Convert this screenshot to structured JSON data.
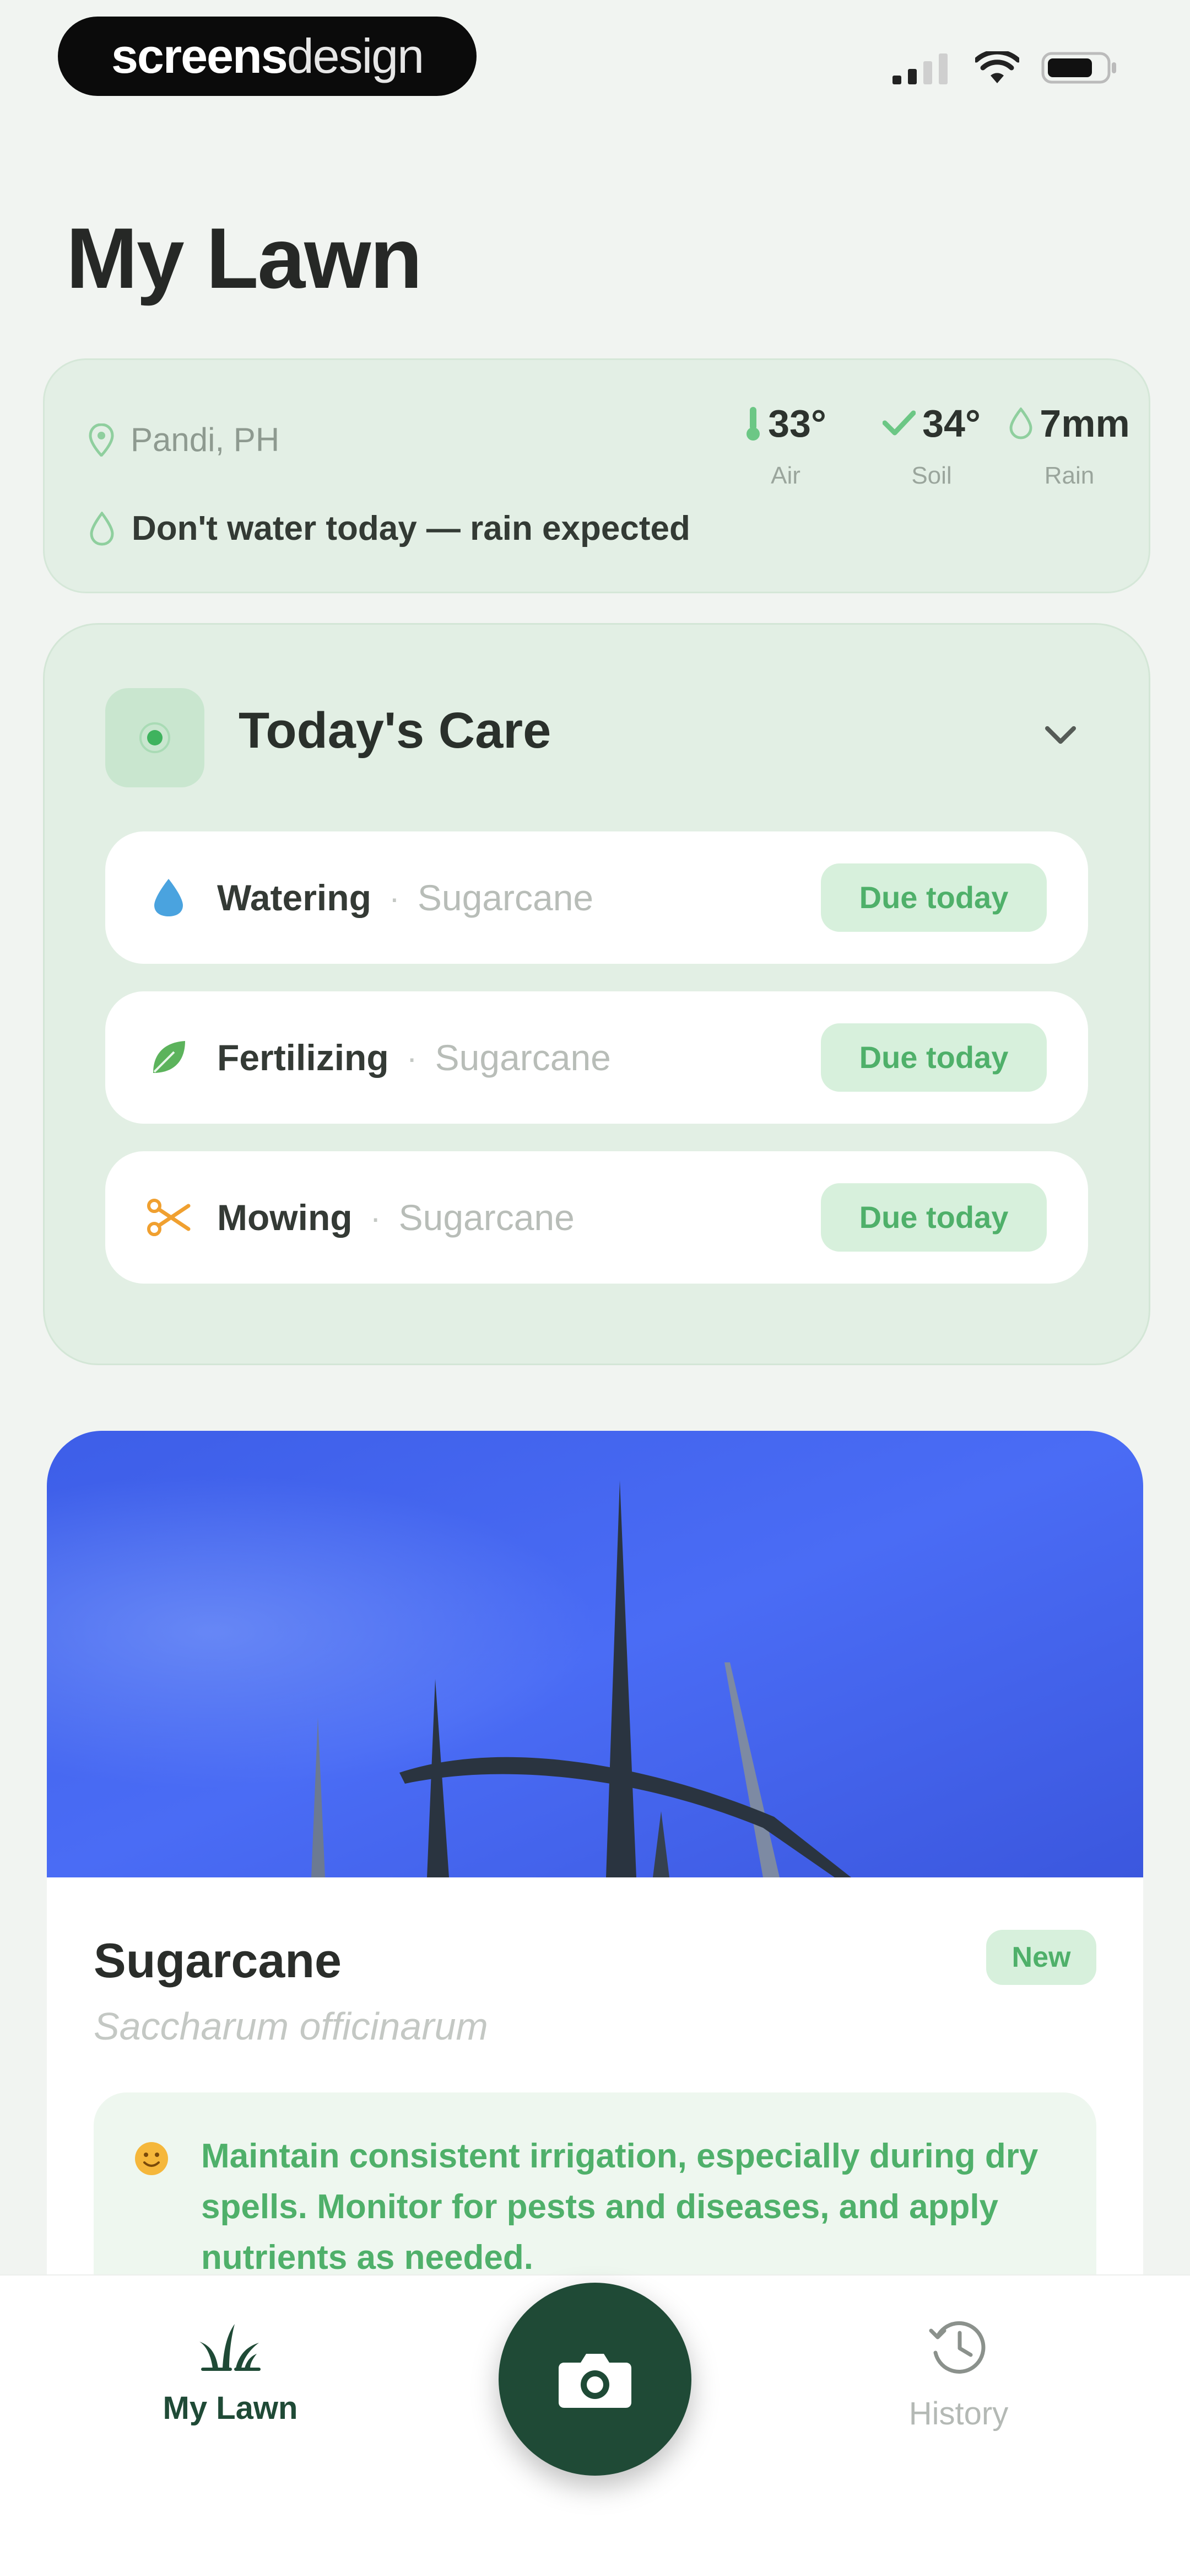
{
  "status_bar": {
    "brand_bold": "screens",
    "brand_light": "design"
  },
  "page": {
    "title": "My Lawn"
  },
  "weather": {
    "location": "Pandi, PH",
    "advice": "Don't water today — rain expected",
    "metrics": [
      {
        "value": "33°",
        "label": "Air",
        "icon": "thermometer-icon"
      },
      {
        "value": "34°",
        "label": "Soil",
        "icon": "leaf-check-icon"
      },
      {
        "value": "7mm",
        "label": "Rain",
        "icon": "drop-icon"
      }
    ]
  },
  "care": {
    "title": "Today's Care",
    "tasks": [
      {
        "name": "Watering",
        "plant": "Sugarcane",
        "status": "Due today",
        "icon": "water-drop-icon",
        "color": "#4aa3df"
      },
      {
        "name": "Fertilizing",
        "plant": "Sugarcane",
        "status": "Due today",
        "icon": "leaf-icon",
        "color": "#5cb35c"
      },
      {
        "name": "Mowing",
        "plant": "Sugarcane",
        "status": "Due today",
        "icon": "scissors-icon",
        "color": "#f0a030"
      }
    ]
  },
  "plant": {
    "name": "Sugarcane",
    "scientific": "Saccharum officinarum",
    "badge": "New",
    "tip": "Maintain consistent irrigation, especially during dry spells. Monitor for pests and diseases, and apply nutrients as needed."
  },
  "nav": {
    "left_label": "My Lawn",
    "right_label": "History"
  },
  "colors": {
    "accent": "#1f4a36",
    "success": "#4fb06a",
    "card_bg": "#e2efe4"
  }
}
